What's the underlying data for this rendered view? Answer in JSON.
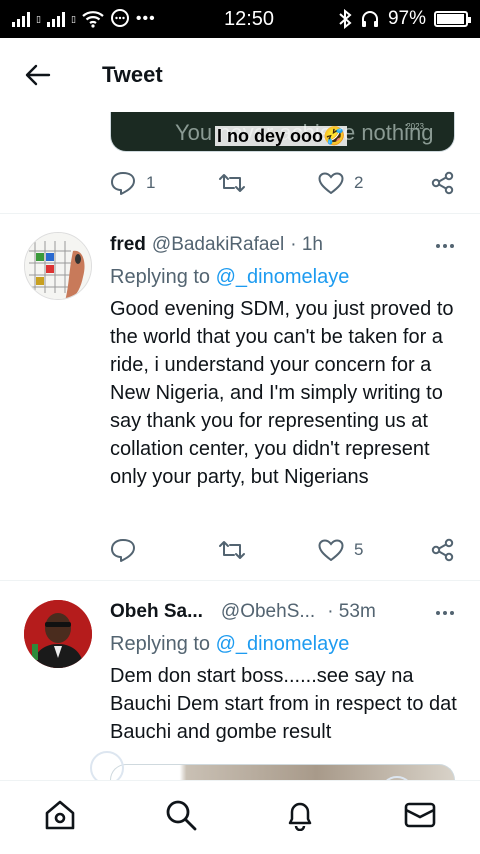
{
  "status_bar": {
    "time": "12:50",
    "battery": "97%",
    "battery_level": 0.97
  },
  "header": {
    "title": "Tweet"
  },
  "previous_tweet": {
    "media_background_text": "You never achieve nothing",
    "media_caption": "I no dey ooo🤣",
    "media_small_text": "2023",
    "reply_count": "1",
    "like_count": "2"
  },
  "tweets": [
    {
      "name": "fred",
      "handle": "@BadakiRafael",
      "time": "· 1h",
      "replying_prefix": "Replying to",
      "replying_to": "@_dinomelaye",
      "body": "Good evening SDM, you just proved to the world that you can't be taken for a ride, i understand your concern for a New Nigeria, and I'm simply writing to say thank you for representing us at collation center, you didn't represent only your party, but Nigerians",
      "like_count": "5"
    },
    {
      "name": "Obeh Sa...",
      "handle": "@ObehS...",
      "time": "· 53m",
      "replying_prefix": "Replying to",
      "replying_to": "@_dinomelaye",
      "body": "Dem don start boss......see say na Bauchi Dem start from in respect to dat Bauchi and gombe result"
    }
  ],
  "bottom_nav": {
    "icons": [
      "home-icon",
      "search-icon",
      "notifications-icon",
      "messages-icon"
    ]
  },
  "colors": {
    "accent": "#1d9bf0",
    "secondary_text": "#536471",
    "text": "#0f1419"
  }
}
